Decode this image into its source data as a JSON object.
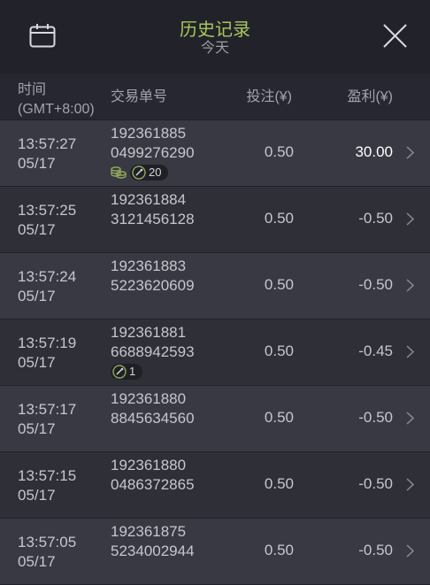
{
  "header": {
    "title": "历史记录",
    "subtitle": "今天"
  },
  "columns": {
    "time_line1": "时间",
    "time_line2": "(GMT+8:00)",
    "order_id": "交易单号",
    "bet": "投注(¥)",
    "profit": "盈利(¥)"
  },
  "colors": {
    "title_accent": "#a7c85a",
    "background": "#2a2b33",
    "win_text": "#ffffff"
  },
  "rows": [
    {
      "time": "13:57:27",
      "date": "05/17",
      "id1": "192361885",
      "id2": "0499276290",
      "bet": "0.50",
      "profit": "30.00",
      "coin": true,
      "badge": "20"
    },
    {
      "time": "13:57:25",
      "date": "05/17",
      "id1": "192361884",
      "id2": "3121456128",
      "bet": "0.50",
      "profit": "-0.50"
    },
    {
      "time": "13:57:24",
      "date": "05/17",
      "id1": "192361883",
      "id2": "5223620609",
      "bet": "0.50",
      "profit": "-0.50"
    },
    {
      "time": "13:57:19",
      "date": "05/17",
      "id1": "192361881",
      "id2": "6688942593",
      "bet": "0.50",
      "profit": "-0.45",
      "coin": false,
      "badge": "1"
    },
    {
      "time": "13:57:17",
      "date": "05/17",
      "id1": "192361880",
      "id2": "8845634560",
      "bet": "0.50",
      "profit": "-0.50"
    },
    {
      "time": "13:57:15",
      "date": "05/17",
      "id1": "192361880",
      "id2": "0486372865",
      "bet": "0.50",
      "profit": "-0.50"
    },
    {
      "time": "13:57:05",
      "date": "05/17",
      "id1": "192361875",
      "id2": "5234002944",
      "bet": "0.50",
      "profit": "-0.50"
    }
  ]
}
